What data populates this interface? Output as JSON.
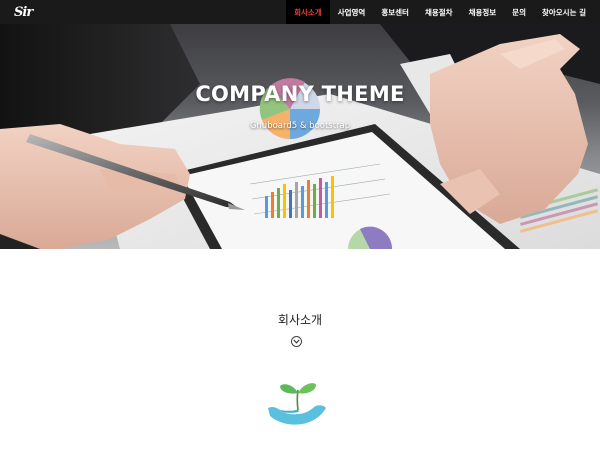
{
  "logo": {
    "text": "Sir"
  },
  "nav": {
    "items": [
      {
        "label": "회사소개",
        "active": true
      },
      {
        "label": "사업영역",
        "active": false
      },
      {
        "label": "홍보센터",
        "active": false
      },
      {
        "label": "채용절차",
        "active": false
      },
      {
        "label": "채용정보",
        "active": false
      },
      {
        "label": "문의",
        "active": false
      },
      {
        "label": "찾아오시는 길",
        "active": false
      }
    ]
  },
  "hero": {
    "title": "COMPANY THEME",
    "subtitle": "Gnuboard5 & bootstrap",
    "image_icon": "business-meeting-photo"
  },
  "section": {
    "title": "회사소개",
    "down_icon": "chevron-down-circle-icon",
    "illustration_icon": "sprout-in-hand-icon"
  },
  "colors": {
    "nav_bg": "#1a1a1a",
    "nav_active_text": "#e8413b",
    "sprout_green": "#5cb85c",
    "hand_blue": "#5bc0de"
  }
}
